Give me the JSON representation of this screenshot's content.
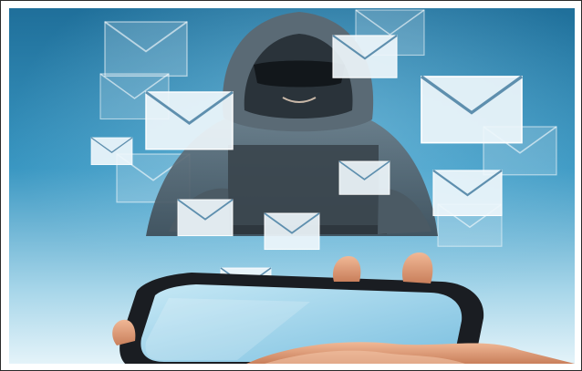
{
  "image": {
    "kind": "photo-illustration",
    "subject": "hooded-figure-with-envelopes-over-smartphone",
    "colors": {
      "sky_top": "#1f6f9a",
      "sky_mid": "#3a97c2",
      "sky_bottom": "#d6ecf5",
      "envelope": "#eef6fb",
      "envelope_line": "#5e8fae",
      "hood": "#4a5b67",
      "phone_body": "#1a1d22",
      "phone_screen": "#9fd2ea",
      "hand": "#e2a07e"
    },
    "icons": [
      "envelope-icon",
      "hooded-figure",
      "smartphone",
      "hand"
    ]
  }
}
